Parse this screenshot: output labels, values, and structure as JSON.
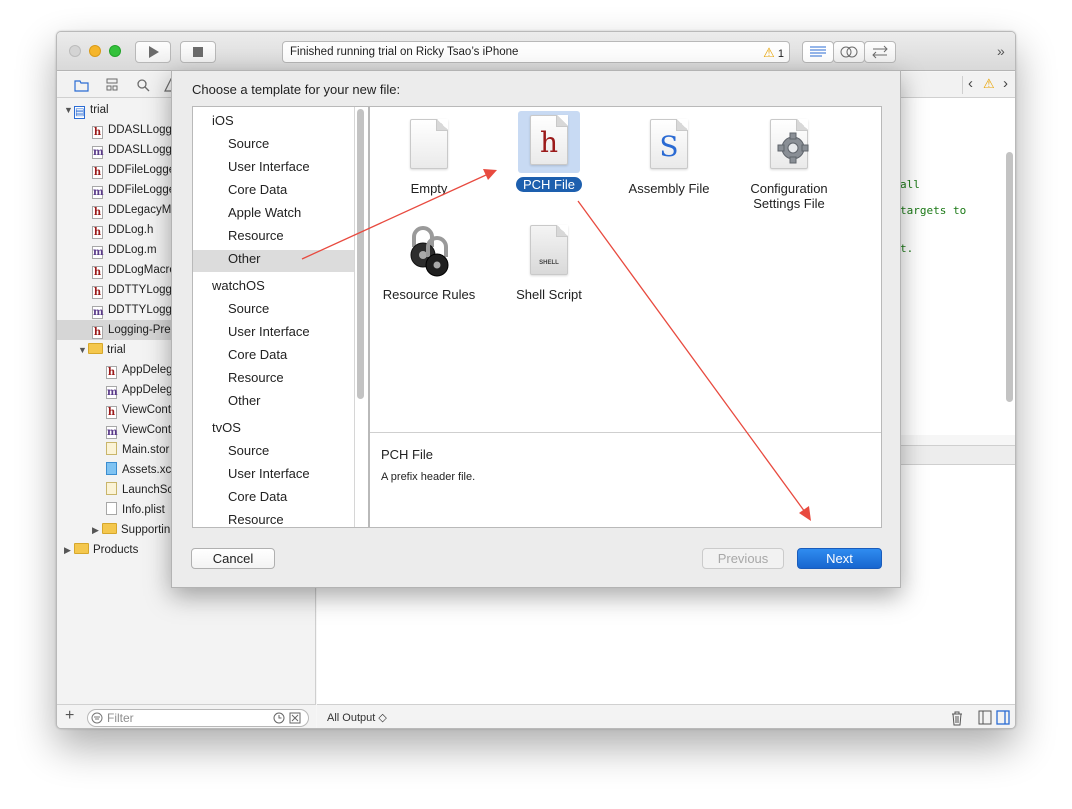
{
  "toolbar": {
    "status_text": "Finished running trial on Ricky Tsao’s iPhone",
    "warning_count": "1"
  },
  "navigator": {
    "items": [
      {
        "label": "trial",
        "icon": "project-icon",
        "level": 0,
        "disclosure": "▼"
      },
      {
        "label": "DDASLLogge",
        "icon": "h"
      },
      {
        "label": "DDASLLogge",
        "icon": "m"
      },
      {
        "label": "DDFileLogge",
        "icon": "h"
      },
      {
        "label": "DDFileLogge",
        "icon": "m"
      },
      {
        "label": "DDLegacyM",
        "icon": "h"
      },
      {
        "label": "DDLog.h",
        "icon": "h"
      },
      {
        "label": "DDLog.m",
        "icon": "m"
      },
      {
        "label": "DDLogMacro",
        "icon": "h"
      },
      {
        "label": "DDTTYLogg",
        "icon": "h"
      },
      {
        "label": "DDTTYLogg",
        "icon": "m"
      },
      {
        "label": "Logging-Pre",
        "icon": "h"
      },
      {
        "label": "trial",
        "icon": "folder",
        "disclosure": "▼"
      },
      {
        "label": "AppDeleg",
        "icon": "h"
      },
      {
        "label": "AppDeleg",
        "icon": "m"
      },
      {
        "label": "ViewCont",
        "icon": "h"
      },
      {
        "label": "ViewCont",
        "icon": "m"
      },
      {
        "label": "Main.stor",
        "icon": "storyboard"
      },
      {
        "label": "Assets.xc",
        "icon": "assets"
      },
      {
        "label": "LaunchSc",
        "icon": "storyboard"
      },
      {
        "label": "Info.plist",
        "icon": "plist"
      },
      {
        "label": "Supportin",
        "icon": "folder",
        "disclosure": "▶"
      },
      {
        "label": "Products",
        "icon": "folder",
        "disclosure": "▶"
      }
    ],
    "filter_placeholder": "Filter"
  },
  "editor": {
    "code_lines": [
      "all",
      "targets to",
      "t."
    ]
  },
  "console": {
    "output_selector": "All Output ◇"
  },
  "sheet": {
    "title": "Choose a template for your new file:",
    "categories": [
      {
        "heading": "iOS",
        "items": [
          "Source",
          "User Interface",
          "Core Data",
          "Apple Watch",
          "Resource",
          "Other"
        ]
      },
      {
        "heading": "watchOS",
        "items": [
          "Source",
          "User Interface",
          "Core Data",
          "Resource",
          "Other"
        ]
      },
      {
        "heading": "tvOS",
        "items": [
          "Source",
          "User Interface",
          "Core Data",
          "Resource"
        ]
      }
    ],
    "selected_category": "Other",
    "templates": [
      {
        "label": "Empty",
        "glyph": ""
      },
      {
        "label": "PCH File",
        "glyph": "h"
      },
      {
        "label": "Assembly File",
        "glyph": "S"
      },
      {
        "label": "Configuration Settings File",
        "glyph": "⚙"
      },
      {
        "label": "Resource Rules",
        "glyph": "🔒"
      },
      {
        "label": "Shell Script",
        "glyph": "SHELL"
      }
    ],
    "selected_template": "PCH File",
    "description_title": "PCH File",
    "description_text": "A prefix header file.",
    "buttons": {
      "cancel": "Cancel",
      "previous": "Previous",
      "next": "Next"
    }
  },
  "colors": {
    "accent": "#1866cf",
    "selection": "#1d5fae",
    "annotation_arrow": "#e84a3f",
    "code_green": "#1c7a17",
    "warning": "#e9a300"
  }
}
